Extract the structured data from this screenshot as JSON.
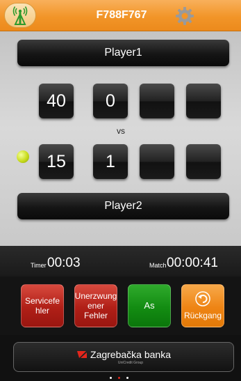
{
  "header": {
    "device_name": "F788F767",
    "antenna_icon": "antenna-signal-icon",
    "settings_icon": "gear-icon"
  },
  "players": {
    "player1": {
      "name": "Player1",
      "scores": [
        "40",
        "0",
        "",
        ""
      ]
    },
    "player2": {
      "name": "Player2",
      "scores": [
        "15",
        "1",
        "",
        ""
      ]
    },
    "vs_label": "vs",
    "serving": "player2"
  },
  "timers": {
    "timer_label": "Timer",
    "timer_value": "00:03",
    "match_label": "Match",
    "match_value": "00:00:41"
  },
  "actions": {
    "service_fault": {
      "line1": "Servicefe",
      "line2": "hler",
      "color": "#b01f17"
    },
    "unforced_error": {
      "line1": "Unerzwung",
      "line2": "ener Fehler",
      "color": "#b01f17"
    },
    "ace": {
      "label": "As",
      "color": "#138c12"
    },
    "undo": {
      "label": "Rückgang",
      "icon": "undo-icon",
      "color": "#ee8414"
    }
  },
  "banner": {
    "bank_name": "Zagrebačka banka",
    "bank_sub": "UniCredit Group",
    "logo_icon": "zaba-logo-icon"
  },
  "pager": {
    "count": 3,
    "active": 1
  }
}
